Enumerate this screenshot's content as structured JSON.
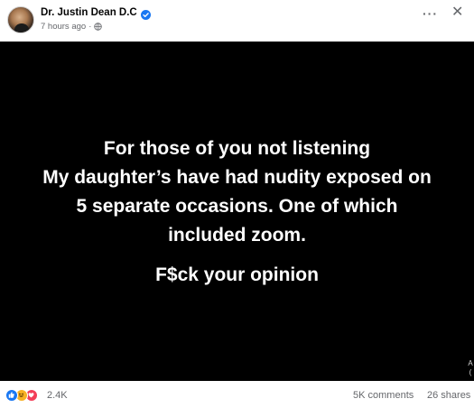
{
  "post": {
    "author": "Dr. Justin Dean D.C",
    "timestamp": "7 hours ago",
    "separator": "·",
    "privacy_icon": "globe-icon",
    "header_icons": [
      "verified-badge-icon",
      "more-options-icon",
      "close-icon"
    ],
    "more_label": "···",
    "close_label": "✕",
    "card": {
      "background": "#000000",
      "text_color": "#ffffff",
      "lines": [
        "For those of you not listening",
        "My daughter’s have had nudity exposed on",
        "5 separate occasions. One of which",
        "included zoom.",
        "F$ck your opinion"
      ],
      "edge_glyphs": [
        "A",
        "("
      ]
    },
    "footer": {
      "reactions": [
        "like-icon",
        "haha-icon",
        "love-icon"
      ],
      "reaction_count": "2.4K",
      "comments": "5K comments",
      "shares": "26 shares"
    }
  },
  "colors": {
    "accent": "#1877f2",
    "secondary_text": "#65676b",
    "like": "#1877f2",
    "haha": "#f7b125",
    "love": "#f33e58"
  }
}
